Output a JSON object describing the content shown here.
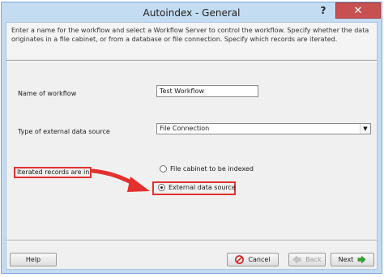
{
  "window": {
    "title": "Autoindex - General",
    "help_glyph": "?",
    "close_glyph": "✕"
  },
  "description": "Enter a name for the workflow and select a Workflow Server to control the workflow. Specify whether the data originates in a file cabinet, or from a database or file connection. Specify which records are iterated.",
  "form": {
    "name_label": "Name of workflow",
    "name_value": "Test Workflow",
    "source_label": "Type of external data source",
    "source_value": "File Connection",
    "iterated_label": "Iterated records are in",
    "options": [
      {
        "label": "File cabinet to be indexed",
        "checked": false
      },
      {
        "label": "External data source",
        "checked": true
      }
    ]
  },
  "annotation": {
    "arrow_color": "#e2312f"
  },
  "buttons": {
    "help": "Help",
    "cancel": "Cancel",
    "back": "Back",
    "next": "Next"
  },
  "icons": {
    "cancel": "cancel-circle-icon",
    "back": "arrow-left-icon",
    "next": "arrow-right-icon"
  }
}
